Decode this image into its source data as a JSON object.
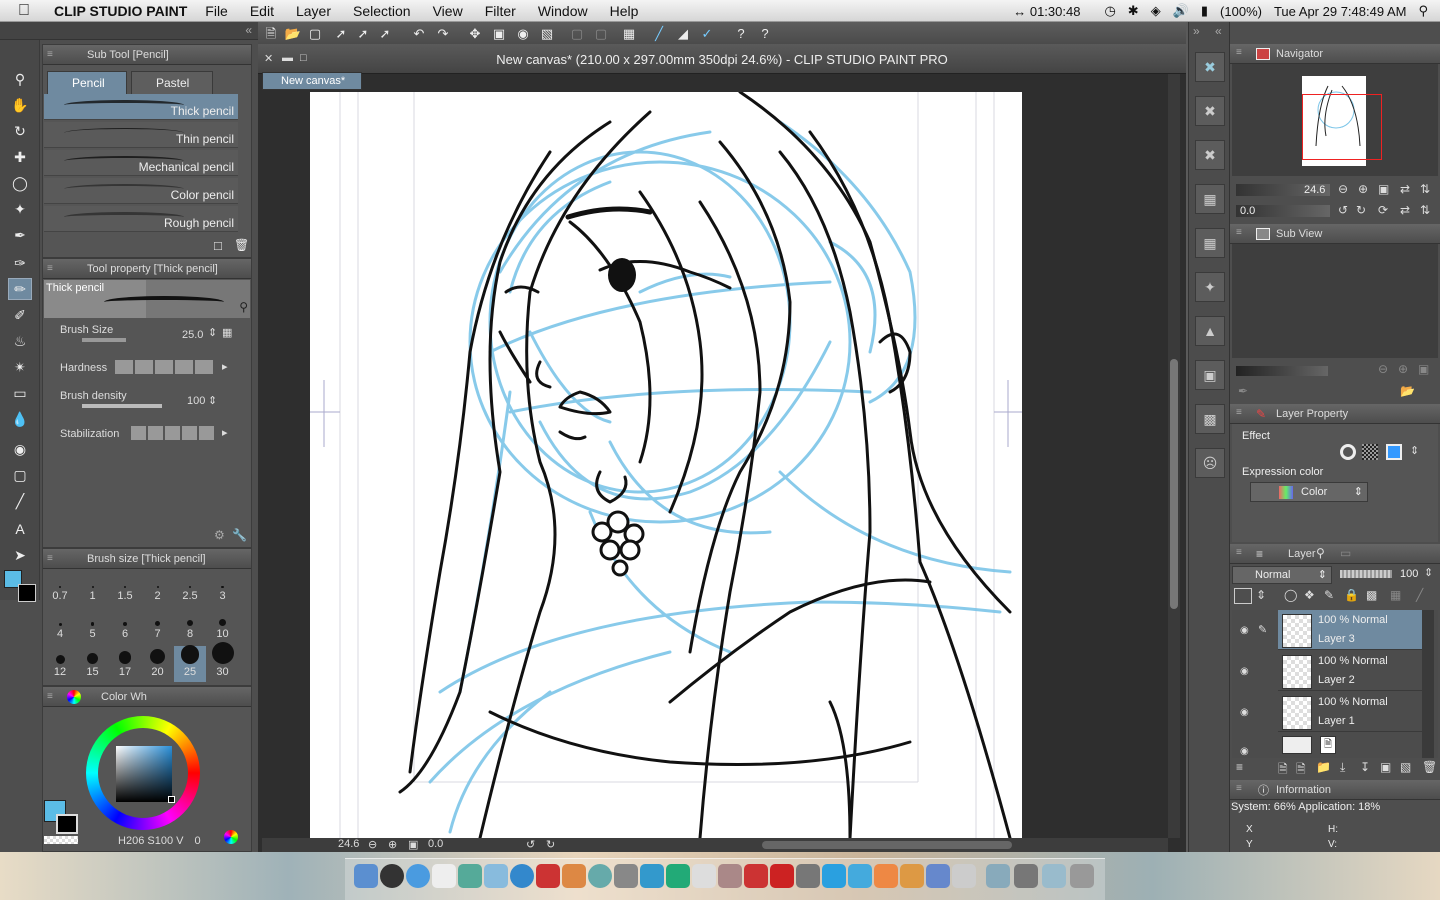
{
  "menubar": {
    "app_name": "CLIP STUDIO PAINT",
    "menus": [
      "File",
      "Edit",
      "Layer",
      "Selection",
      "View",
      "Filter",
      "Window",
      "Help"
    ],
    "timer": "01:30:48",
    "battery": "(100%)",
    "datetime": "Tue Apr 29  7:48:49 AM"
  },
  "subtool": {
    "header": "Sub Tool [Pencil]",
    "tabs": [
      "Pencil",
      "Pastel"
    ],
    "brushes": [
      "Thick pencil",
      "Thin pencil",
      "Mechanical pencil",
      "Color pencil",
      "Rough pencil"
    ]
  },
  "toolprop": {
    "header": "Tool property [Thick pencil]",
    "preview_label": "Thick pencil",
    "brush_size_label": "Brush Size",
    "brush_size_value": "25.0",
    "hardness_label": "Hardness",
    "density_label": "Brush density",
    "density_value": "100",
    "stabilization_label": "Stabilization"
  },
  "brushsize": {
    "header": "Brush size [Thick pencil]",
    "sizes": [
      "0.7",
      "1",
      "1.5",
      "2",
      "2.5",
      "3",
      "4",
      "5",
      "6",
      "7",
      "8",
      "10",
      "12",
      "15",
      "17",
      "20",
      "25",
      "30"
    ]
  },
  "colorwheel": {
    "header": "Color Wh",
    "h_label": "H",
    "h_value": "206",
    "s_label": "S",
    "s_value": "100",
    "v_label": "V",
    "v_value": "0"
  },
  "document": {
    "title": "New canvas* (210.00 x 297.00mm 350dpi 24.6%)  - CLIP STUDIO PAINT PRO",
    "tab": "New canvas*",
    "zoom": "24.6",
    "angle": "0.0"
  },
  "navigator": {
    "header": "Navigator",
    "zoom": "24.6",
    "angle": "0.0"
  },
  "subview": {
    "header": "Sub View"
  },
  "layerprop": {
    "header": "Layer Property",
    "effect_label": "Effect",
    "expression_label": "Expression color",
    "expression_value": "Color"
  },
  "layers": {
    "header": "Layer",
    "blend_mode": "Normal",
    "opacity": "100",
    "items": [
      {
        "mode": "100 % Normal",
        "name": "Layer 3"
      },
      {
        "mode": "100 % Normal",
        "name": "Layer 2"
      },
      {
        "mode": "100 % Normal",
        "name": "Layer 1"
      }
    ]
  },
  "information": {
    "header": "Information",
    "system": "System: 66% Application: 18%",
    "x_label": "X",
    "y_label": "Y",
    "h_label": "H:",
    "v_label": "V:"
  },
  "colors": {
    "main_color": "#5bbce6",
    "sub_color": "#000000",
    "selection": "#6f8aa0",
    "sketch_blue": "#7cc5e8"
  }
}
